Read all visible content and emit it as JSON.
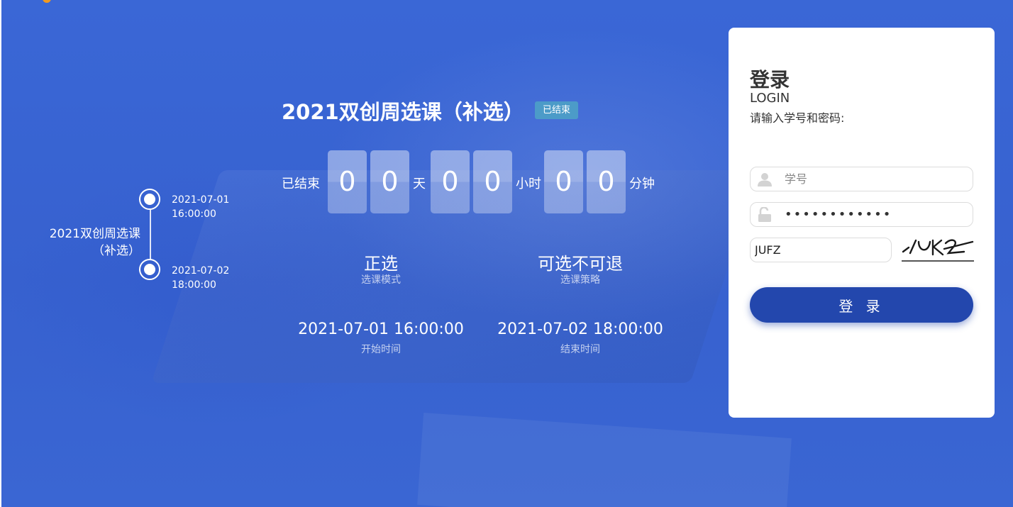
{
  "timeline": {
    "name_line1": "2021双创周选课",
    "name_line2": "（补选）",
    "start_date": "2021-07-01",
    "start_time": "16:00:00",
    "end_date": "2021-07-02",
    "end_time": "18:00:00"
  },
  "course": {
    "title": "2021双创周选课（补选）",
    "status_badge": "已结束",
    "status_badge_color": "#4c9bc8"
  },
  "countdown": {
    "prefix": "已结束",
    "days_digits": [
      "0",
      "0"
    ],
    "days_unit": "天",
    "hours_digits": [
      "0",
      "0"
    ],
    "hours_unit": "小时",
    "minutes_digits": [
      "0",
      "0"
    ],
    "minutes_unit": "分钟"
  },
  "info": {
    "mode_value": "正选",
    "mode_label": "选课模式",
    "strategy_value": "可选不可退",
    "strategy_label": "选课策略",
    "start_time_value": "2021-07-01 16:00:00",
    "start_time_label": "开始时间",
    "end_time_value": "2021-07-02 18:00:00",
    "end_time_label": "结束时间"
  },
  "login": {
    "title": "登录",
    "subtitle": "LOGIN",
    "hint": "请输入学号和密码:",
    "username_placeholder": "学号",
    "username_value": "",
    "password_value": "············",
    "captcha_value": "JUFZ",
    "captcha_image_text": "JUFZ",
    "button_label": "登 录",
    "button_color": "#2347ad"
  },
  "colors": {
    "background": "#3761cf",
    "card": "#ffffff"
  }
}
